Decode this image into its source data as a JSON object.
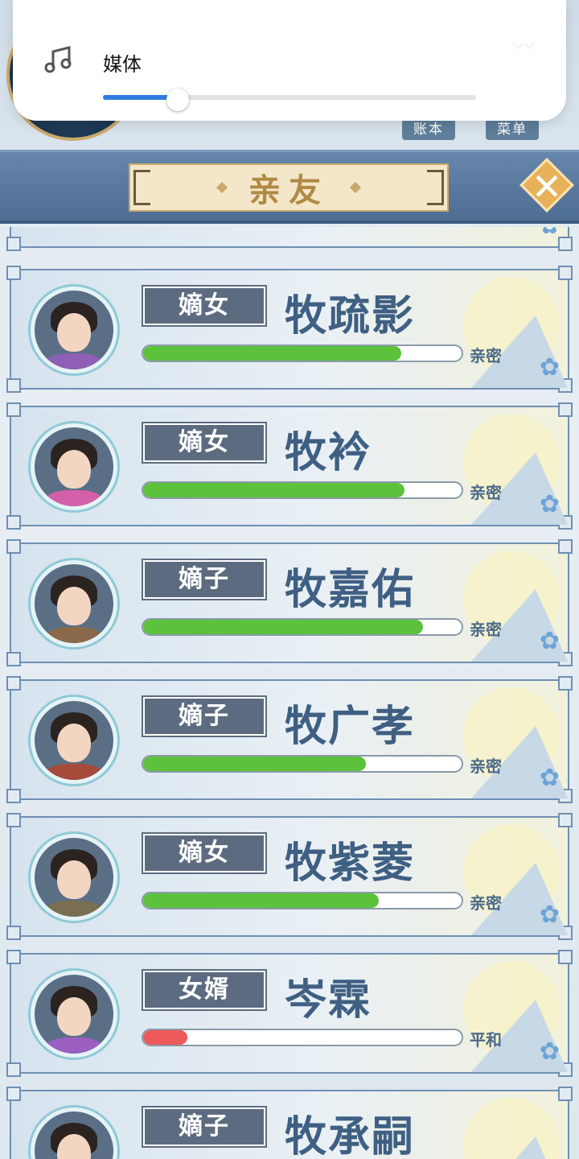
{
  "volume_popup": {
    "label": "媒体",
    "level": 0.2,
    "accent": "#2f7de1"
  },
  "header": {
    "ledger_label": "账本",
    "menu_label": "菜单"
  },
  "banner": {
    "title": "亲友"
  },
  "relatives": [
    {
      "role": "嫡女",
      "name": "牧疏影",
      "intimacy": 0.81,
      "status": "亲密",
      "bar_color": "#5cc23c",
      "robe": "#8e5fb5"
    },
    {
      "role": "嫡女",
      "name": "牧衿",
      "intimacy": 0.82,
      "status": "亲密",
      "bar_color": "#5cc23c",
      "robe": "#d35fa8"
    },
    {
      "role": "嫡子",
      "name": "牧嘉佑",
      "intimacy": 0.88,
      "status": "亲密",
      "bar_color": "#5cc23c",
      "robe": "#8a6a4a"
    },
    {
      "role": "嫡子",
      "name": "牧广孝",
      "intimacy": 0.7,
      "status": "亲密",
      "bar_color": "#5cc23c",
      "robe": "#a64a3a"
    },
    {
      "role": "嫡女",
      "name": "牧紫菱",
      "intimacy": 0.74,
      "status": "亲密",
      "bar_color": "#5cc23c",
      "robe": "#7a6f52"
    },
    {
      "role": "女婿",
      "name": "岑霖",
      "intimacy": 0.14,
      "status": "平和",
      "bar_color": "#ee5a5a",
      "robe": "#9a5fc0"
    },
    {
      "role": "嫡子",
      "name": "牧承嗣",
      "intimacy": 0.0,
      "status": "",
      "bar_color": "#5cc23c",
      "robe": "#4a6fa8"
    }
  ]
}
